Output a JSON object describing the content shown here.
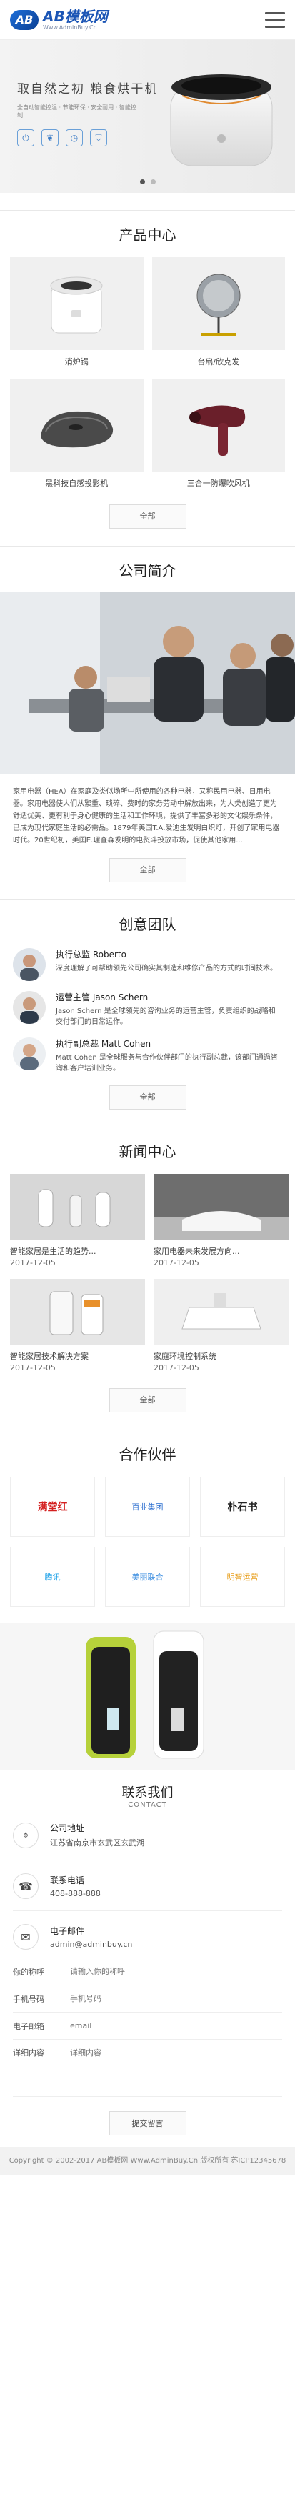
{
  "header": {
    "logo_mark": "AB",
    "logo_title": "AB模板网",
    "logo_sub": "Www.AdminBuy.Cn"
  },
  "banner": {
    "title": "取自然之初  粮食烘干机",
    "desc": "全自动智能控温 · 节能环保 · 安全耐用 · 智能控制",
    "icons": [
      "power-icon",
      "leaf-icon",
      "clock-icon",
      "shield-icon"
    ]
  },
  "products": {
    "title": "产品中心",
    "items": [
      {
        "caption": "消炉锅"
      },
      {
        "caption": "台扇/欣克发"
      },
      {
        "caption": "黑科技自感投影机"
      },
      {
        "caption": "三合一防爆吹风机"
      }
    ],
    "more": "全部"
  },
  "about": {
    "title": "公司简介",
    "text": "家用电器（HEA）在家庭及类似场所中所使用的各种电器，又称民用电器、日用电器。家用电器使人们从繁重、琐碎、费时的家务劳动中解放出来，为人类创造了更为舒适优美、更有利于身心健康的生活和工作环境，提供了丰富多彩的文化娱乐条件，已成为现代家庭生活的必需品。1879年美国T.A.爱迪生发明白炽灯，开创了家用电器时代。20世纪初，美国E.理查森发明的电熨斗投放市场，促使其他家用...",
    "more": "全部"
  },
  "team": {
    "title": "创意团队",
    "members": [
      {
        "name": "执行总监 Roberto",
        "desc": "深度理解了可帮助领先公司确实其制造和维修产品的方式的时间技术。"
      },
      {
        "name": "运营主管 Jason Schern",
        "desc": "Jason Schern 是全球领先的咨询业务的运营主管，负责组织的战略和交付部门的日常运作。"
      },
      {
        "name": "执行副总裁 Matt Cohen",
        "desc": "Matt Cohen 是全球服务与合作伙伴部门的执行副总裁，该部门通過咨询和客户培训业务。"
      }
    ],
    "more": "全部"
  },
  "news": {
    "title": "新闻中心",
    "items": [
      {
        "caption": "智能家居是生活的趋势...",
        "date": "2017-12-05"
      },
      {
        "caption": "家用电器未来发展方向...",
        "date": "2017-12-05"
      },
      {
        "caption": "智能家居技术解决方案",
        "date": "2017-12-05"
      },
      {
        "caption": "家庭环境控制系统",
        "date": "2017-12-05"
      }
    ],
    "more": "全部"
  },
  "partners": {
    "title": "合作伙伴",
    "items": [
      {
        "name": "满堂红",
        "color": "#d42020"
      },
      {
        "name": "百业集团",
        "color": "#2d6fd0"
      },
      {
        "name": "朴石书",
        "color": "#222222"
      },
      {
        "name": "腾讯",
        "color": "#1aa0e8"
      },
      {
        "name": "美丽联合",
        "color": "#3a8de0"
      },
      {
        "name": "明智运营",
        "color": "#e8a020"
      }
    ]
  },
  "contact": {
    "title": "联系我们",
    "sub": "CONTACT",
    "address_label": "公司地址",
    "address": "江苏省南京市玄武区玄武湖",
    "phone_label": "联系电话",
    "phone": "408-888-888",
    "email_label": "电子邮件",
    "email": "admin@adminbuy.cn"
  },
  "form": {
    "name_label": "你的称呼",
    "name_ph": "请输入你的称呼",
    "phone_label": "手机号码",
    "phone_ph": "手机号码",
    "email_label": "电子邮箱",
    "email_ph": "email",
    "content_label": "详细内容",
    "content_ph": "详细内容",
    "submit": "提交留言"
  },
  "footer": {
    "text": "Copyright © 2002-2017 AB模板网 Www.AdminBuy.Cn 版权所有 苏ICP12345678"
  }
}
